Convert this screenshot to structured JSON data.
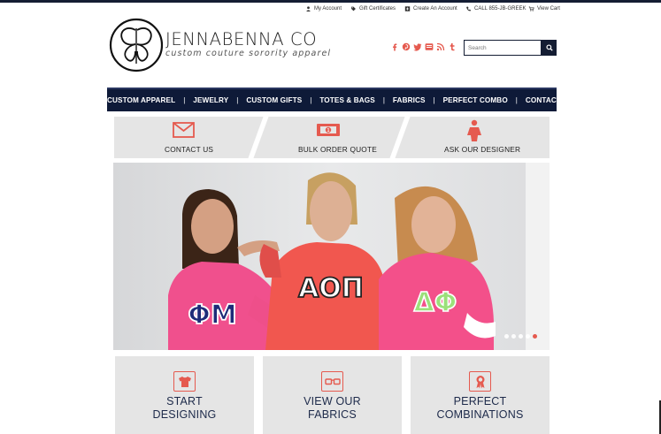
{
  "utility_bar": {
    "my_account": "My Account",
    "gift_certificates": "Gift Certificates",
    "create_account": "Create An Account",
    "call": "CALL 855-JB-GREEK",
    "view_cart": "View Cart"
  },
  "logo": {
    "title": "JENNABENNA CO",
    "tagline": "custom couture sorority apparel"
  },
  "social": [
    "facebook-icon",
    "pinterest-icon",
    "twitter-icon",
    "youtube-icon",
    "rss-icon",
    "tumblr-icon"
  ],
  "search": {
    "placeholder": "Search"
  },
  "nav": {
    "items": [
      "CUSTOM APPAREL",
      "JEWELRY",
      "CUSTOM GIFTS",
      "TOTES & BAGS",
      "FABRICS",
      "PERFECT COMBO",
      "CONTACT US"
    ]
  },
  "quick_links": [
    {
      "label": "CONTACT US",
      "icon": "envelope-icon"
    },
    {
      "label": "BULK ORDER QUOTE",
      "icon": "money-icon"
    },
    {
      "label": "ASK OUR DESIGNER",
      "icon": "person-icon"
    }
  ],
  "hero": {
    "shirts": [
      "ΦΜ",
      "ΑΟΠ",
      "ΔΦ"
    ],
    "slides_total": 5,
    "active_slide": 5
  },
  "tiles": [
    {
      "line1": "START",
      "line2": "DESIGNING",
      "icon": "tshirt-icon"
    },
    {
      "line1": "VIEW OUR",
      "line2": "FABRICS",
      "icon": "glasses-icon"
    },
    {
      "line1": "PERFECT",
      "line2": "COMBINATIONS",
      "icon": "ribbon-icon"
    }
  ],
  "colors": {
    "navy": "#0e1a38",
    "accent": "#e55a4f",
    "tile_bg": "#e5e5e5"
  }
}
